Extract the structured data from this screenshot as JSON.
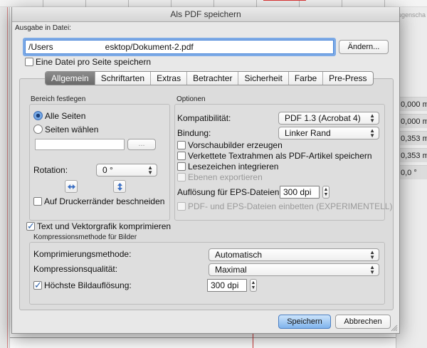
{
  "background": {
    "panel_title": "ugenscha",
    "panel_values": [
      "0,000 m",
      "0,000 m",
      "0,353 m",
      "0,353 m",
      "0,0 °"
    ]
  },
  "dialog": {
    "title": "Als PDF speichern",
    "output": {
      "label": "Ausgabe in Datei:",
      "path_prefix": "/Users",
      "path_suffix": "esktop/Dokument-2.pdf",
      "change_button": "Ändern...",
      "one_file_per_page": {
        "label": "Eine Datei pro Seite speichern",
        "checked": false
      }
    },
    "tabs": [
      "Allgemein",
      "Schriftarten",
      "Extras",
      "Betrachter",
      "Sicherheit",
      "Farbe",
      "Pre-Press"
    ],
    "active_tab": "Allgemein",
    "range": {
      "label": "Bereich festlegen",
      "all_pages": {
        "label": "Alle Seiten",
        "selected": true
      },
      "select_pages": {
        "label": "Seiten wählen",
        "selected": false
      },
      "pages_value": "",
      "pages_button": "...",
      "rotation_label": "Rotation:",
      "rotation_value": "0 °",
      "crop_printer_marks": {
        "label": "Auf Druckerränder beschneiden",
        "checked": false
      }
    },
    "options": {
      "label": "Optionen",
      "compat_label": "Kompatibilität:",
      "compat_value": "PDF 1.3 (Acrobat 4)",
      "binding_label": "Bindung:",
      "binding_value": "Linker Rand",
      "checks": [
        {
          "label": "Vorschaubilder erzeugen",
          "checked": false,
          "disabled": false
        },
        {
          "label": "Verkettete Textrahmen als PDF-Artikel speichern",
          "checked": false,
          "disabled": false
        },
        {
          "label": "Lesezeichen integrieren",
          "checked": false,
          "disabled": false
        },
        {
          "label": "Ebenen exportieren",
          "checked": false,
          "disabled": true
        }
      ],
      "eps_res_label": "Auflösung für EPS-Dateien:",
      "eps_res_value": "300 dpi",
      "embed_eps": {
        "label": "PDF- und EPS-Dateien einbetten (EXPERIMENTELL)",
        "checked": false,
        "disabled": true
      }
    },
    "compress_text": {
      "label": "Text und Vektorgrafik komprimieren",
      "checked": true
    },
    "image_compression": {
      "label": "Kompressionsmethode für Bilder",
      "method_label": "Komprimierungsmethode:",
      "method_value": "Automatisch",
      "quality_label": "Kompressionsqualität:",
      "quality_value": "Maximal",
      "max_res": {
        "label": "Höchste Bildauflösung:",
        "checked": true
      },
      "max_res_value": "300 dpi"
    },
    "buttons": {
      "save": "Speichern",
      "cancel": "Abbrechen"
    }
  }
}
